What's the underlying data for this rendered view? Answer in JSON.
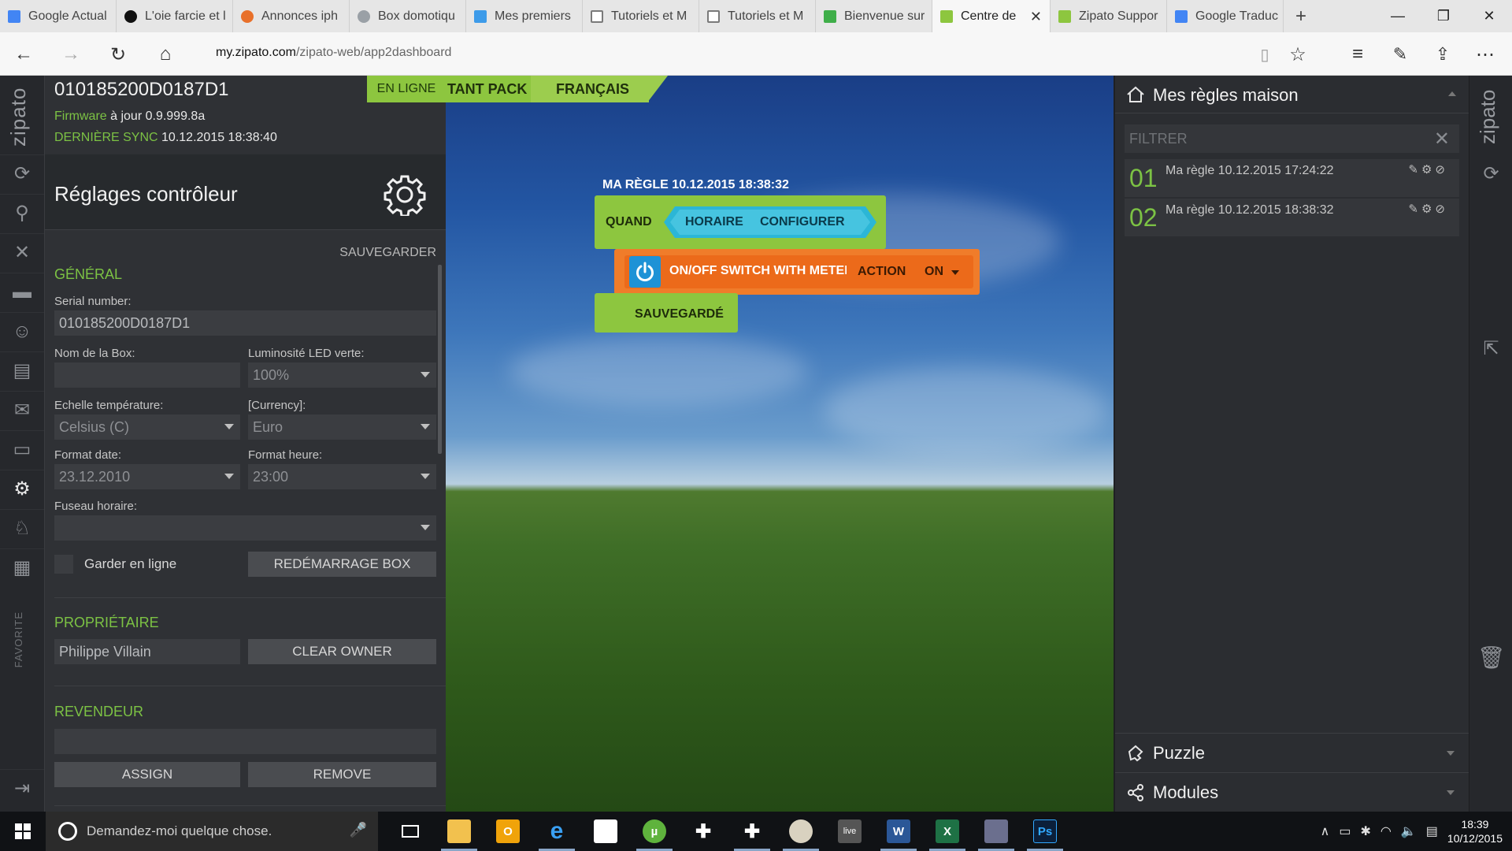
{
  "browser": {
    "tabs": [
      {
        "label": "Google Actual",
        "color": "#4285f4",
        "active": false
      },
      {
        "label": "L'oie farcie et l",
        "color": "#111111",
        "active": false
      },
      {
        "label": "Annonces iph",
        "color": "#e8702a",
        "active": false
      },
      {
        "label": "Box domotiqu",
        "color": "#9aa0a6",
        "active": false
      },
      {
        "label": "Mes premiers",
        "color": "#3d9be9",
        "active": false
      },
      {
        "label": "Tutoriels et M",
        "color": "#7a7a7a",
        "active": false
      },
      {
        "label": "Tutoriels et M",
        "color": "#7a7a7a",
        "active": false
      },
      {
        "label": "Bienvenue sur",
        "color": "#3fae49",
        "active": false
      },
      {
        "label": "Centre de",
        "color": "#8dc63f",
        "active": true
      },
      {
        "label": "Zipato Suppor",
        "color": "#8dc63f",
        "active": false
      },
      {
        "label": "Google Traduc",
        "color": "#4285f4",
        "active": false
      }
    ],
    "url_domain": "my.zipato.com",
    "url_path": "/zipato-web/app2dashboard"
  },
  "left_rail": {
    "logo": "zipato",
    "favorite": "FAVORITE",
    "icons": [
      "sync-icon",
      "search-icon",
      "tools-icon",
      "scenes-icon",
      "users-icon",
      "contacts-icon",
      "messages-icon",
      "folder-icon",
      "settings-icon",
      "awards-icon",
      "calendar-icon",
      "logout-icon"
    ]
  },
  "controller": {
    "serial": "010185200D0187D1",
    "status": "EN LIGNE",
    "firmware_label": "Firmware",
    "firmware_value": "à jour 0.9.999.8a",
    "sync_label": "DERNIÈRE SYNC",
    "sync_value": "10.12.2015 18:38:40",
    "settings_title": "Réglages contrôleur",
    "save_label": "SAUVEGARDER"
  },
  "general": {
    "title": "GÉNÉRAL",
    "serial_label": "Serial number:",
    "serial_value": "010185200D0187D1",
    "box_name_label": "Nom de la Box:",
    "box_name_value": "",
    "led_label": "Luminosité LED verte:",
    "led_value": "100%",
    "temp_label": "Echelle température:",
    "temp_value": "Celsius (C)",
    "currency_label": "[Currency]:",
    "currency_value": "Euro",
    "date_label": "Format date:",
    "date_value": "23.12.2010",
    "time_label": "Format heure:",
    "time_value": "23:00",
    "tz_label": "Fuseau horaire:",
    "tz_value": "",
    "keep_online_label": "Garder en ligne",
    "reboot_label": "REDÉMARRAGE BOX"
  },
  "owner": {
    "title": "PROPRIÉTAIRE",
    "name": "Philippe Villain",
    "clear_label": "CLEAR OWNER"
  },
  "reseller": {
    "title": "REVENDEUR",
    "value": "",
    "assign_label": "ASSIGN",
    "remove_label": "REMOVE"
  },
  "canvas_tabs": {
    "tab1": "TANT PACK",
    "tab2": "FRANÇAIS"
  },
  "rule": {
    "title": "MA RÈGLE 10.12.2015 18:38:32",
    "when": "QUAND",
    "schedule": "HORAIRE",
    "configure": "CONFIGURER",
    "device": "ON/OFF SWITCH WITH METER",
    "action": "ACTION",
    "state": "ON",
    "saved": "SAUVEGARDÉ"
  },
  "rules_panel": {
    "title": "Mes règles maison",
    "filter_placeholder": "FILTRER",
    "rules": [
      {
        "num": "01",
        "name": "Ma règle 10.12.2015 17:24:22"
      },
      {
        "num": "02",
        "name": "Ma règle 10.12.2015 18:38:32"
      }
    ],
    "puzzle": "Puzzle",
    "modules": "Modules"
  },
  "right_rail": {
    "logo": "zipato"
  },
  "taskbar": {
    "search_placeholder": "Demandez-moi quelque chose.",
    "time": "18:39",
    "date": "10/12/2015"
  },
  "colors": {
    "accent_green": "#8dc63f",
    "action_orange": "#f07c2a",
    "schedule_cyan": "#2bb6d6",
    "power_blue": "#1e92d6"
  }
}
